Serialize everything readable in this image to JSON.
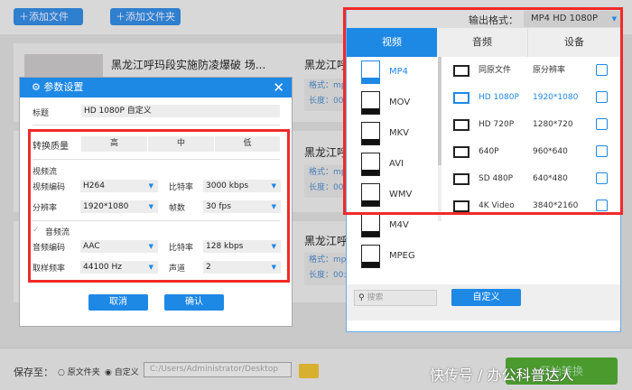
{
  "toolbar": {
    "add_file": "添加文件",
    "add_folder": "添加文件夹",
    "plus_icon": "plus-icon"
  },
  "files": [
    {
      "title": "黑龙江呼玛段实施防凌爆破 场...",
      "title2": "黑龙江呼",
      "format_label": "格式：mp",
      "length_label": "长度：00:"
    },
    {
      "title2": "黑龙江呼",
      "format_label": "格式：mp",
      "length_label": "长度：00:"
    },
    {
      "title": "黑龙江呼",
      "title2": "黑龙江呼",
      "format_label": "格式：mp",
      "length_label": "长度：00:"
    }
  ],
  "dialog": {
    "title": "参数设置",
    "title_label": "标题",
    "title_value": "HD 1080P 自定义",
    "quality_label": "转换质量",
    "quality": [
      "高",
      "中",
      "低"
    ],
    "video_section": "视频流",
    "video_codec_label": "视频编码",
    "video_codec": "H264",
    "video_bitrate_label": "比特率",
    "video_bitrate": "3000 kbps",
    "resolution_label": "分辨率",
    "resolution": "1920*1080",
    "fps_label": "帧数",
    "fps": "30 fps",
    "audio_section": "音频流",
    "audio_enabled": true,
    "audio_codec_label": "音频编码",
    "audio_codec": "AAC",
    "audio_bitrate_label": "比特率",
    "audio_bitrate": "128 kbps",
    "sample_label": "取样频率",
    "sample": "44100 Hz",
    "channel_label": "声道",
    "channel": "2",
    "cancel": "取消",
    "confirm": "确认"
  },
  "output": {
    "label": "输出格式：",
    "value": "MP4  HD 1080P",
    "tabs": [
      "视频",
      "音频",
      "设备"
    ],
    "formats": [
      "MP4",
      "MOV",
      "MKV",
      "AVI",
      "WMV",
      "M4V",
      "MPEG"
    ],
    "selected_format": "MP4",
    "presets": [
      {
        "name": "同原文件",
        "res": "原分辨率"
      },
      {
        "name": "HD 1080P",
        "res": "1920*1080"
      },
      {
        "name": "HD 720P",
        "res": "1280*720"
      },
      {
        "name": "640P",
        "res": "960*640"
      },
      {
        "name": "SD 480P",
        "res": "640*480"
      },
      {
        "name": "4K Video",
        "res": "3840*2160"
      }
    ],
    "search_placeholder": "搜索",
    "custom": "自定义"
  },
  "bottom": {
    "save_to": "保存至：",
    "opt_original": "原文件夹",
    "opt_custom": "自定义",
    "path": "C:/Users/Administrator/Desktop",
    "start": "开始转换"
  },
  "watermark": "快传号 / 办公科普达人",
  "colors": {
    "accent": "#1e88e5",
    "highlight": "#f02a2a",
    "start": "#4a9a2e"
  }
}
